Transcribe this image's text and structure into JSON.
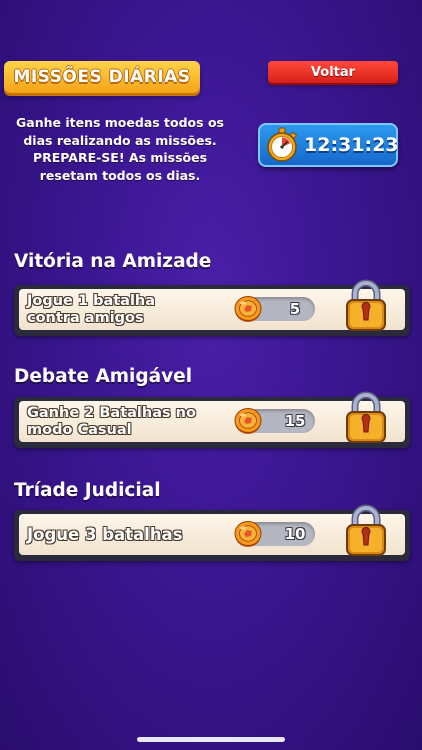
{
  "header": {
    "title": "MISSÕES DIÁRIAS",
    "back_label": "Voltar"
  },
  "description": {
    "line1": "Ganhe itens moedas todos os",
    "line2": "dias realizando as missões.",
    "line3": "PREPARE-SE! As missões",
    "line4": "resetam todos os dias."
  },
  "timer": {
    "value": "12:31:23",
    "icon": "stopwatch-icon"
  },
  "missions": [
    {
      "title": "Vitória na Amizade",
      "task_line1": "Jogue 1 batalha",
      "task_line2": "contra amigos",
      "reward": "5",
      "reward_icon": "coin-icon",
      "status_icon": "padlock-icon"
    },
    {
      "title": "Debate Amigável",
      "task_line1": "Ganhe 2 Batalhas no",
      "task_line2": "modo Casual",
      "reward": "15",
      "reward_icon": "coin-icon",
      "status_icon": "padlock-icon"
    },
    {
      "title": "Tríade Judicial",
      "task_line1": "Jogue 3 batalhas",
      "reward": "10",
      "reward_icon": "coin-icon",
      "status_icon": "padlock-icon"
    }
  ],
  "colors": {
    "background": "#3a1690",
    "title_badge": "#f5a318",
    "back_button": "#d81f1a",
    "timer": "#1565c9"
  }
}
